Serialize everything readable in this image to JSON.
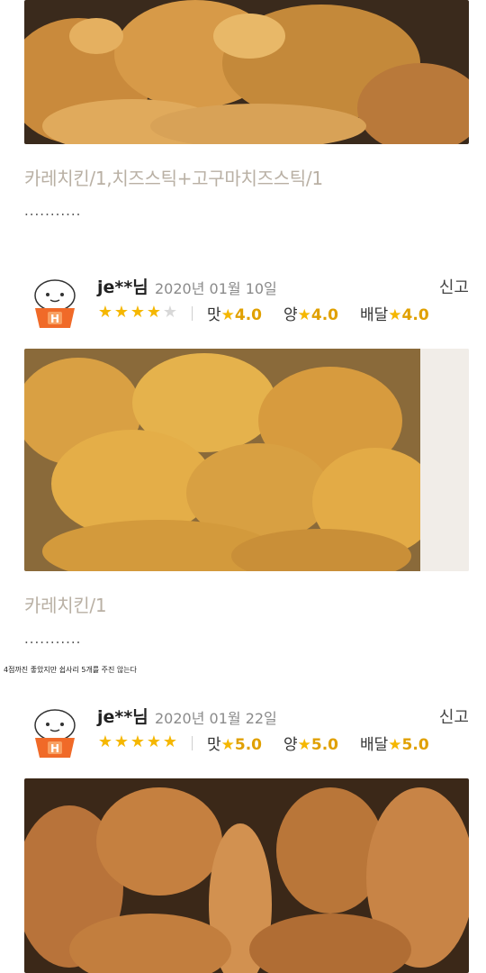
{
  "reviews": [
    {
      "order_text": "카레치킨/1,치즈스틱+고구마치즈스틱/1",
      "more": "..........."
    },
    {
      "user": "je**님",
      "date": "2020년 01월 10일",
      "report_label": "신고",
      "star_rating": 4,
      "star_max": 5,
      "taste_label": "맛",
      "taste_value": "4.0",
      "amount_label": "양",
      "amount_value": "4.0",
      "delivery_label": "배달",
      "delivery_value": "4.0",
      "order_text": "카레치킨/1",
      "more": "..........."
    },
    {
      "user": "je**님",
      "date": "2020년 01월 22일",
      "report_label": "신고",
      "star_rating": 5,
      "star_max": 5,
      "taste_label": "맛",
      "taste_value": "5.0",
      "amount_label": "양",
      "amount_value": "5.0",
      "delivery_label": "배달",
      "delivery_value": "5.0"
    }
  ],
  "caption": "4점까진 좋았지만 쉽사리 5개를 주진 않는다",
  "star_glyph": "★",
  "avatar_badge": "H",
  "colors": {
    "star": "#f5b700",
    "avatar_body": "#f06a28",
    "order_text": "#b9b0a4"
  },
  "icons": [
    "avatar-mascot-icon",
    "star-icon"
  ]
}
